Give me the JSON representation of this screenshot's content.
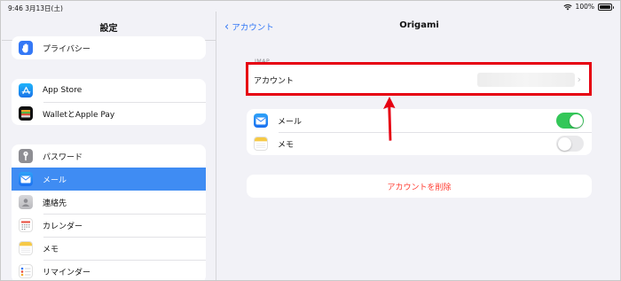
{
  "status_bar": {
    "time": "9:46 3月13日(土)",
    "battery": "100%",
    "battery_level": 1.0
  },
  "sidebar": {
    "title": "設定",
    "groups": [
      {
        "items": [
          {
            "label": "プライバシー",
            "icon": "hand-icon",
            "color": "#3478f6"
          }
        ]
      },
      {
        "items": [
          {
            "label": "App Store",
            "icon": "app-store-icon",
            "color": "#1a8cf5"
          },
          {
            "label": "WalletとApple Pay",
            "icon": "wallet-icon",
            "color": "#111111"
          }
        ]
      },
      {
        "items": [
          {
            "label": "パスワード",
            "icon": "key-icon",
            "color": "#8e8e93"
          },
          {
            "label": "メール",
            "icon": "mail-icon",
            "color": "#2b7ef5",
            "selected": true
          },
          {
            "label": "連絡先",
            "icon": "contacts-icon",
            "color": "#c9c9cc"
          },
          {
            "label": "カレンダー",
            "icon": "calendar-icon",
            "color": "#ffffff"
          },
          {
            "label": "メモ",
            "icon": "notes-icon",
            "color": "#f6c945"
          },
          {
            "label": "リマインダー",
            "icon": "reminders-icon",
            "color": "#ffffff"
          }
        ]
      }
    ]
  },
  "detail": {
    "back_label": "アカウント",
    "title": "Origami",
    "section_label": "IMAP",
    "account_row_label": "アカウント",
    "toggles": [
      {
        "label": "メール",
        "icon": "mail-icon",
        "on": true
      },
      {
        "label": "メモ",
        "icon": "notes-icon",
        "on": false
      }
    ],
    "delete_label": "アカウントを削除"
  },
  "colors": {
    "accent": "#3478f6",
    "toggle_on": "#34c759",
    "toggle_off": "#e9e9eb",
    "destructive": "#ff3b30",
    "highlight": "#e60012"
  }
}
